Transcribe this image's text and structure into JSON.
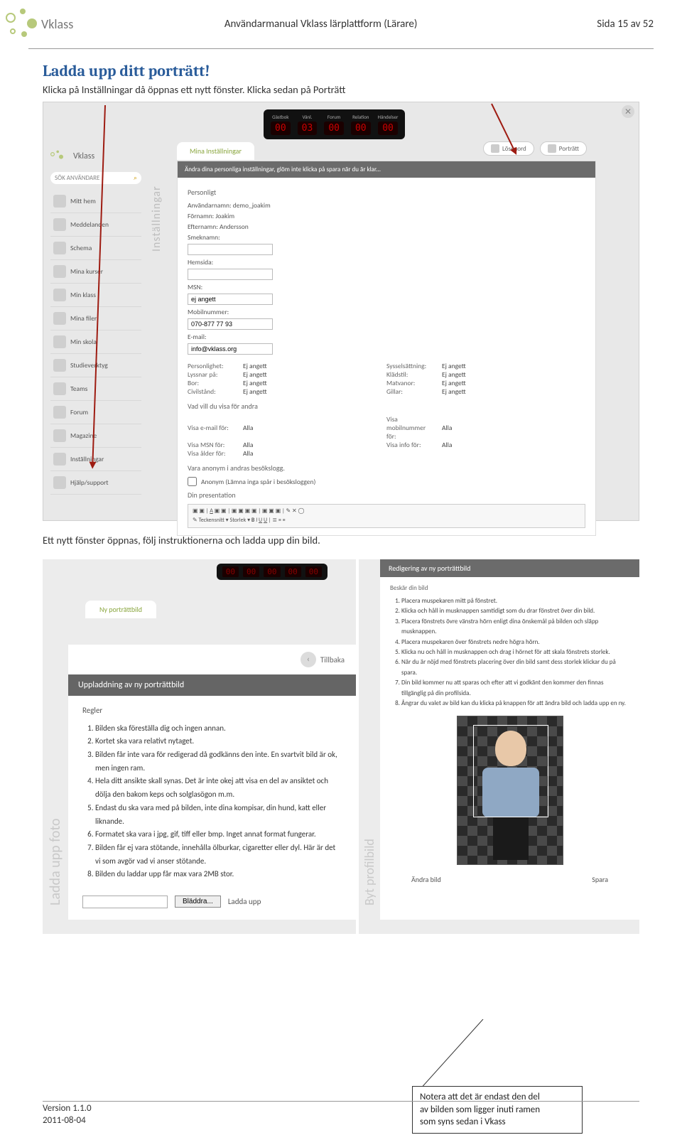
{
  "doc": {
    "logo_text": "Vklass",
    "header_title": "Användarmanual Vklass lärplattform (Lärare)",
    "page_label": "Sida 15 av 52",
    "footer_version": "Version 1.1.0",
    "footer_date": "2011-08-04"
  },
  "section1": {
    "title": "Ladda upp ditt porträtt!",
    "text": "Klicka på Inställningar då öppnas ett nytt fönster. Klicka sedan på Porträtt"
  },
  "shot1": {
    "close": "✕",
    "leds": [
      {
        "label": "Gästbok",
        "value": "00"
      },
      {
        "label": "Vänl.",
        "value": "03"
      },
      {
        "label": "Forum",
        "value": "00"
      },
      {
        "label": "Relation",
        "value": "00"
      },
      {
        "label": "Händelser",
        "value": "00"
      }
    ],
    "mini_logo": "Vklass",
    "search": "SÖK ANVÄNDARE",
    "nav": [
      "Mitt hem",
      "Meddelanden",
      "Schema",
      "Mina kurser",
      "Min klass",
      "Mina filer",
      "Min skola",
      "Studieverktyg",
      "Teams",
      "Forum",
      "Magazine",
      "Inställningar",
      "Hjälp/support"
    ],
    "vtab": "Inställningar",
    "tab_mina": "Mina Inställningar",
    "pill_losen": "Lösenord",
    "pill_portratt": "Porträtt",
    "darkbar": "Ändra dina personliga inställningar, glöm inte klicka på spara när du är klar...",
    "personligt": "Personligt",
    "anvnamn_lbl": "Användarnamn:",
    "anvnamn_val": "demo_joakim",
    "fornamn_lbl": "Förnamn:",
    "fornamn_val": "Joakim",
    "efternamn_lbl": "Efternamn:",
    "efternamn_val": "Andersson",
    "smeknamn_lbl": "Smeknamn:",
    "hemsida_lbl": "Hemsida:",
    "msn_lbl": "MSN:",
    "msn_val": "ej angett",
    "mobil_lbl": "Mobilnummer:",
    "mobil_val": "070-877 77 93",
    "email_lbl": "E-mail:",
    "email_val": "info@vklass.org",
    "grid": [
      {
        "l1": "Personlighet:",
        "v1": "Ej angett",
        "l2": "Sysselsättning:",
        "v2": "Ej angett"
      },
      {
        "l1": "Lyssnar på:",
        "v1": "Ej angett",
        "l2": "Klädstil:",
        "v2": "Ej angett"
      },
      {
        "l1": "Bor:",
        "v1": "Ej angett",
        "l2": "Matvanor:",
        "v2": "Ej angett"
      },
      {
        "l1": "Civilstånd:",
        "v1": "Ej angett",
        "l2": "Gillar:",
        "v2": "Ej angett"
      }
    ],
    "vad_vill": "Vad vill du visa för andra",
    "visa_rows": [
      {
        "l1": "Visa e-mail för:",
        "v1": "Alla",
        "l2": "Visa mobilnummer för:",
        "v2": "Alla"
      },
      {
        "l1": "Visa MSN för:",
        "v1": "Alla",
        "l2": "Visa info för:",
        "v2": "Alla"
      },
      {
        "l1": "Visa ålder för:",
        "v1": "Alla",
        "l2": "",
        "v2": ""
      }
    ],
    "anonym_hdr": "Vara anonym i andras besökslogg.",
    "anonym_chk": "Anonym (Lämna inga spår i besöksloggen)",
    "presentation": "Din presentation",
    "tb_font": "Teckensnitt",
    "tb_size": "Storlek"
  },
  "between_text": "Ett nytt fönster öppnas, följ instruktionerna och ladda upp din bild.",
  "shot2": {
    "tab_ny": "Ny porträttbild",
    "vtab_ladda": "Ladda upp foto",
    "tillbaka": "Tillbaka",
    "dark2": "Uppladdning av ny porträttbild",
    "regler": "Regler",
    "rules": [
      "Bilden ska föreställa dig och ingen annan.",
      "Kortet ska vara relativt nytaget.",
      "Bilden får inte vara för redigerad då godkänns den inte. En svartvit bild är ok, men ingen ram.",
      "Hela ditt ansikte skall synas. Det är inte okej att visa en del av ansiktet och dölja den bakom keps och solglasögon m.m.",
      "Endast du ska vara med på bilden, inte dina kompisar, din hund, katt eller liknande.",
      "Formatet ska vara i jpg, gif, tiff eller bmp. Inget annat format fungerar.",
      "Bilden får ej vara stötande, innehålla ölburkar, cigaretter eller dyl. Här är det vi som avgör vad vi anser stötande.",
      "Bilden du laddar upp får max vara 2MB stor."
    ],
    "bladdra": "Bläddra...",
    "laddaupp": "Ladda upp",
    "vtab_byt": "Byt profilbild",
    "dark3": "Redigering av ny porträttbild",
    "beskar": "Beskär din bild",
    "steps": [
      "Placera muspekaren mitt på fönstret.",
      "Klicka och håll in musknappen samtidigt som du drar fönstret över din bild.",
      "Placera fönstrets övre vänstra hörn enligt dina önskemål på bilden och släpp musknappen.",
      "Placera muspekaren över fönstrets nedre högra hörn.",
      "Klicka nu och håll in musknappen och drag i hörnet för att skala fönstrets storlek.",
      "När du är nöjd med fönstrets placering över din bild samt dess storlek klickar du på spara.",
      "Din bild kommer nu att sparas och efter att vi godkänt den kommer den finnas tillgänglig på din profilsida.",
      "Ångrar du valet av bild kan du klicka på knappen för att ändra bild och ladda upp en ny."
    ],
    "andra": "Ändra bild",
    "spara": "Spara"
  },
  "callout": {
    "l1": "Notera att det är endast den del",
    "l2": "av bilden som ligger inuti ramen",
    "l3": "som syns sedan i Vkass"
  }
}
